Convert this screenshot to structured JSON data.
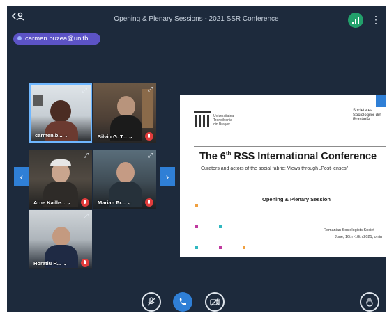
{
  "window": {
    "title": "Opening & Plenary Sessions - 2021 SSR Conference"
  },
  "current_user": {
    "email": "carmen.buzea@unitb..."
  },
  "participants": [
    {
      "name": "carmen.b...",
      "chevron": "⌄"
    },
    {
      "name": "Silviu G. T...",
      "chevron": "⌄"
    },
    {
      "name": "Arne Kaille...",
      "chevron": "⌄"
    },
    {
      "name": "Marian Pr...",
      "chevron": "⌄"
    },
    {
      "name": "Horatiu R...",
      "chevron": "⌄"
    }
  ],
  "slide": {
    "university": "Universitatea Transilvania din Braşov",
    "society": "Societatea Sociologilor din România",
    "heading_prefix": "The 6",
    "heading_sup": "th",
    "heading_suffix": " RSS International Conference",
    "subtitle": "Curators and actors of the social fabric: Views through „Post-lenses\"",
    "session": "Opening & Plenary Session",
    "organizer": "Romanian Sociologists Societ",
    "date": "June, 16th -18th 2021, onlin"
  },
  "icons": {
    "back": "back-arrow-icon",
    "signal": "signal-icon",
    "more": "more-vertical-icon",
    "mic": "microphone-muted-icon",
    "call": "phone-icon",
    "video": "camera-off-icon",
    "hand": "raise-hand-icon"
  },
  "colors": {
    "background": "#1d2a3c",
    "accent": "#2f7fd6",
    "pill": "#5c53c5",
    "muted": "#e23c3c",
    "signal": "#22a06b"
  }
}
